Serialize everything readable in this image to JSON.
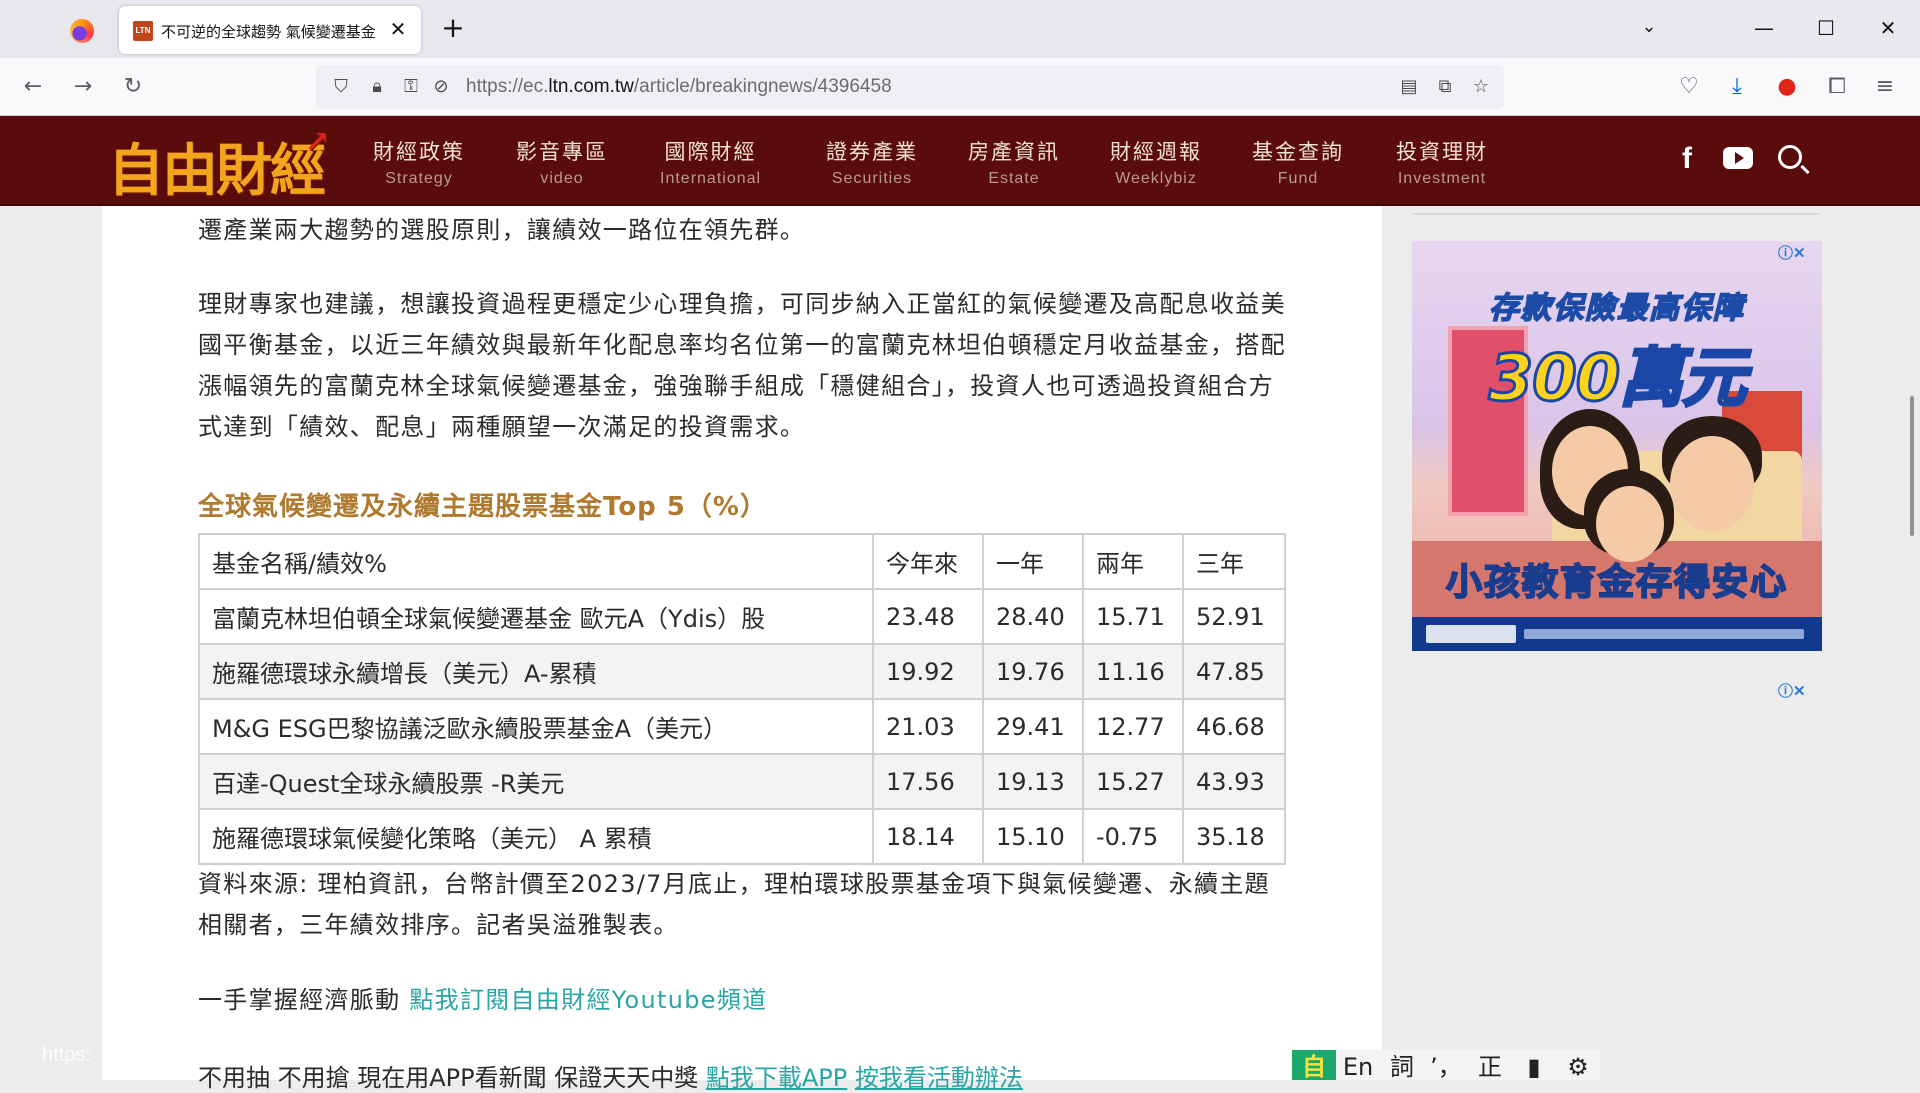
{
  "browser": {
    "tab_title": "不可逆的全球趨勢 氣候變遷基金",
    "tab_favicon_text": "LTN",
    "url_prefix": "https://ec.",
    "url_domain": "ltn.com.tw",
    "url_path": "/article/breakingnews/4396458",
    "icons": [
      "firefox-icon",
      "close-icon",
      "plus-icon",
      "chevron-down-icon",
      "minimize-icon",
      "maximize-icon",
      "back-icon",
      "forward-icon",
      "reload-icon",
      "shield-icon",
      "lock-icon",
      "permissions-icon",
      "tracking-off-icon",
      "reader-view-icon",
      "picture-in-picture-icon",
      "star-icon",
      "pocket-icon",
      "download-icon",
      "extension-icon",
      "puzzle-icon",
      "menu-icon"
    ]
  },
  "site": {
    "logo": "自由財經",
    "menu": [
      {
        "zh": "財經政策",
        "en": "Strategy"
      },
      {
        "zh": "影音專區",
        "en": "video"
      },
      {
        "zh": "國際財經",
        "en": "International"
      },
      {
        "zh": "證券產業",
        "en": "Securities"
      },
      {
        "zh": "房產資訊",
        "en": "Estate"
      },
      {
        "zh": "財經週報",
        "en": "Weeklybiz"
      },
      {
        "zh": "基金查詢",
        "en": "Fund"
      },
      {
        "zh": "投資理財",
        "en": "Investment"
      }
    ],
    "colors": {
      "header_bg": "#5a0c0c",
      "logo": "#f3a51d",
      "subhead": "#b07a2e",
      "link": "#2aa5a5"
    }
  },
  "article": {
    "p0": "遷產業兩大趨勢的選股原則，讓績效一路位在領先群。",
    "p1": "理財專家也建議，想讓投資過程更穩定少心理負擔，可同步納入正當紅的氣候變遷及高配息收益美國平衡基金，以近三年績效與最新年化配息率均名位第一的富蘭克林坦伯頓穩定月收益基金，搭配漲幅領先的富蘭克林全球氣候變遷基金，強強聯手組成「穩健組合」，投資人也可透過投資組合方式達到「績效、配息」兩種願望一次滿足的投資需求。",
    "subhead": "全球氣候變遷及永續主題股票基金Top 5（%）",
    "table": {
      "headers": [
        "基金名稱/績效%",
        "今年來",
        "一年",
        "兩年",
        "三年"
      ],
      "rows": [
        [
          "富蘭克林坦伯頓全球氣候變遷基金 歐元A（Ydis）股",
          "23.48",
          "28.40",
          "15.71",
          "52.91"
        ],
        [
          "施羅德環球永續增長（美元）A-累積",
          "19.92",
          "19.76",
          "11.16",
          "47.85"
        ],
        [
          "M&G ESG巴黎協議泛歐永續股票基金A（美元）",
          "21.03",
          "29.41",
          "12.77",
          "46.68"
        ],
        [
          "百達-Quest全球永續股票 -R美元",
          "17.56",
          "19.13",
          "15.27",
          "43.93"
        ],
        [
          "施羅德環球氣候變化策略（美元） A 累積",
          "18.14",
          "15.10",
          "-0.75",
          "35.18"
        ]
      ]
    },
    "source": "資料來源: 理柏資訊，台幣計價至2023/7月底止，理柏環球股票基金項下與氣候變遷、永續主題相關者，三年績效排序。記者吳溢雅製表。",
    "sub_prefix": "一手掌握經濟脈動 ",
    "sub_link": "點我訂閱自由財經Youtube頻道",
    "app_prefix": "不用抽 不用搶 現在用APP看新聞 保證天天中獎 ",
    "app_link1": "點我下載APP",
    "app_link2": "按我看活動辦法"
  },
  "ad": {
    "line1": "存款保險最高保障",
    "line2": "300萬元",
    "line3": "小孩教育金存得安心",
    "info": "ⓘ✕"
  },
  "ime": [
    "自",
    "En",
    "詞",
    "’，",
    "正",
    "▮",
    "⚙"
  ],
  "status_hint": "https:"
}
